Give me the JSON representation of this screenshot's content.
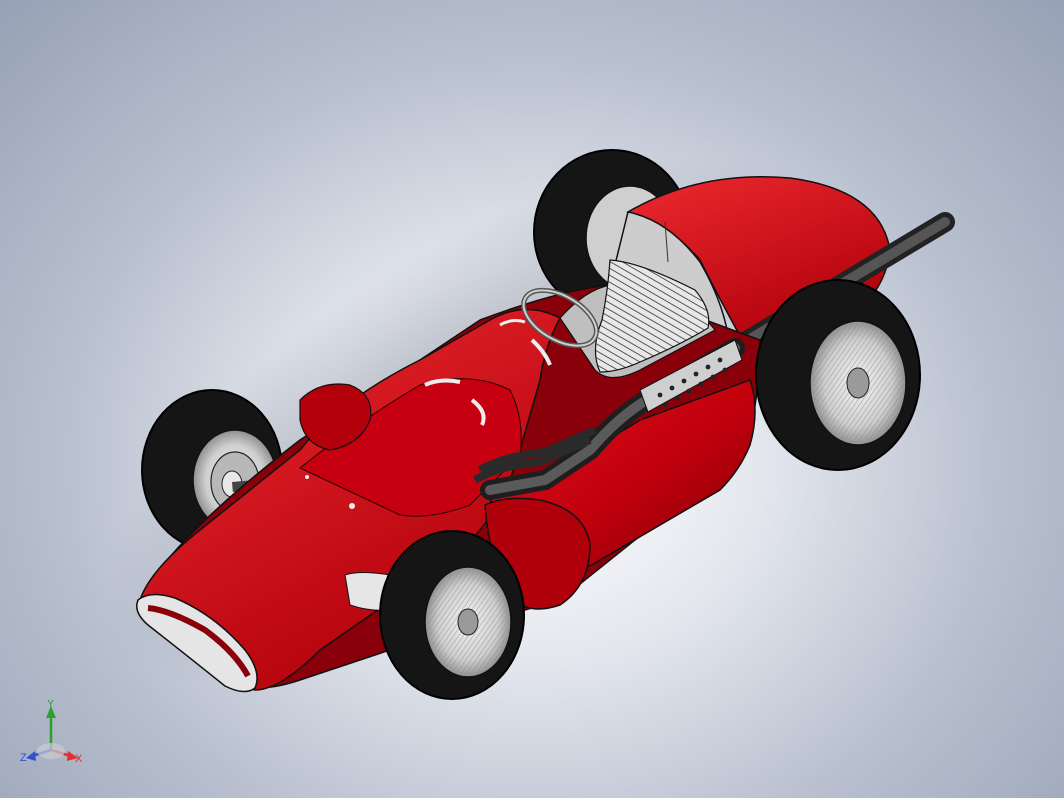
{
  "view": {
    "type": "3d-cad-model-viewport",
    "subject": "",
    "colors": {
      "background_center": "#ffffff",
      "background_edge": "#97a1b5",
      "body_red": "#c0000c",
      "body_red_dark": "#7a0008",
      "tire_black": "#151515",
      "rim_silver": "#d6d6d6",
      "exhaust_grey": "#3a3a3a"
    }
  },
  "triad": {
    "x_label": "X",
    "y_label": "Y",
    "z_label": "Z",
    "x_color": "#e03030",
    "y_color": "#2e9e2e",
    "z_color": "#3050d0"
  }
}
